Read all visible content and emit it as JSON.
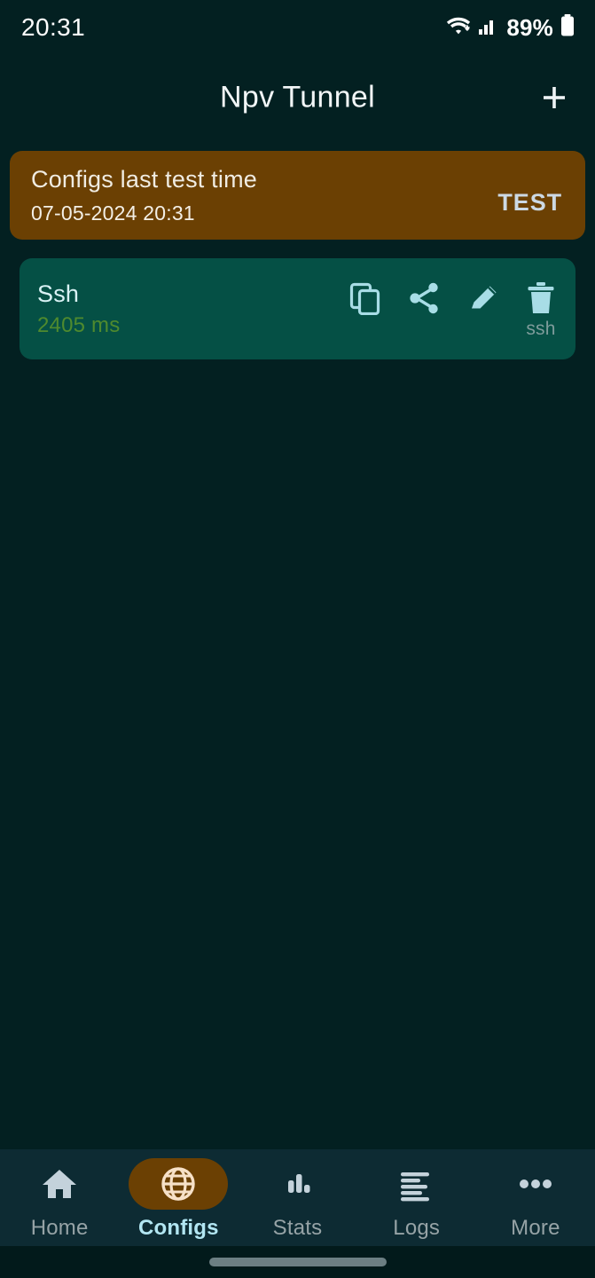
{
  "status_bar": {
    "time": "20:31",
    "battery_percent": "89%",
    "wifi_icon": "wifi-icon",
    "signal_icon": "cellular-signal-icon",
    "battery_icon": "battery-icon"
  },
  "app_bar": {
    "title": "Npv Tunnel",
    "add_icon": "plus-icon"
  },
  "test_banner": {
    "title": "Configs last test time",
    "timestamp": "07-05-2024 20:31",
    "test_label": "TEST",
    "background_color": "#6b4003"
  },
  "configs": [
    {
      "name": "Ssh",
      "ping": "2405 ms",
      "type_label": "ssh",
      "background_color": "#055045",
      "actions": [
        {
          "name": "copy-icon",
          "sublabel": ""
        },
        {
          "name": "share-icon",
          "sublabel": ""
        },
        {
          "name": "edit-icon",
          "sublabel": ""
        },
        {
          "name": "delete-icon",
          "sublabel": "ssh"
        }
      ]
    }
  ],
  "bottom_nav": {
    "items": [
      {
        "label": "Home",
        "icon": "home-icon",
        "active": false
      },
      {
        "label": "Configs",
        "icon": "globe-icon",
        "active": true
      },
      {
        "label": "Stats",
        "icon": "bar-chart-icon",
        "active": false
      },
      {
        "label": "Logs",
        "icon": "list-lines-icon",
        "active": false
      },
      {
        "label": "More",
        "icon": "more-dots-icon",
        "active": false
      }
    ],
    "active_color": "#b2e6f2",
    "inactive_color": "#96a3a6",
    "pill_color": "#6b4003"
  },
  "theme": {
    "background": "#032021",
    "nav_background": "#0d2b33",
    "gesture_background": "#021a1b"
  }
}
